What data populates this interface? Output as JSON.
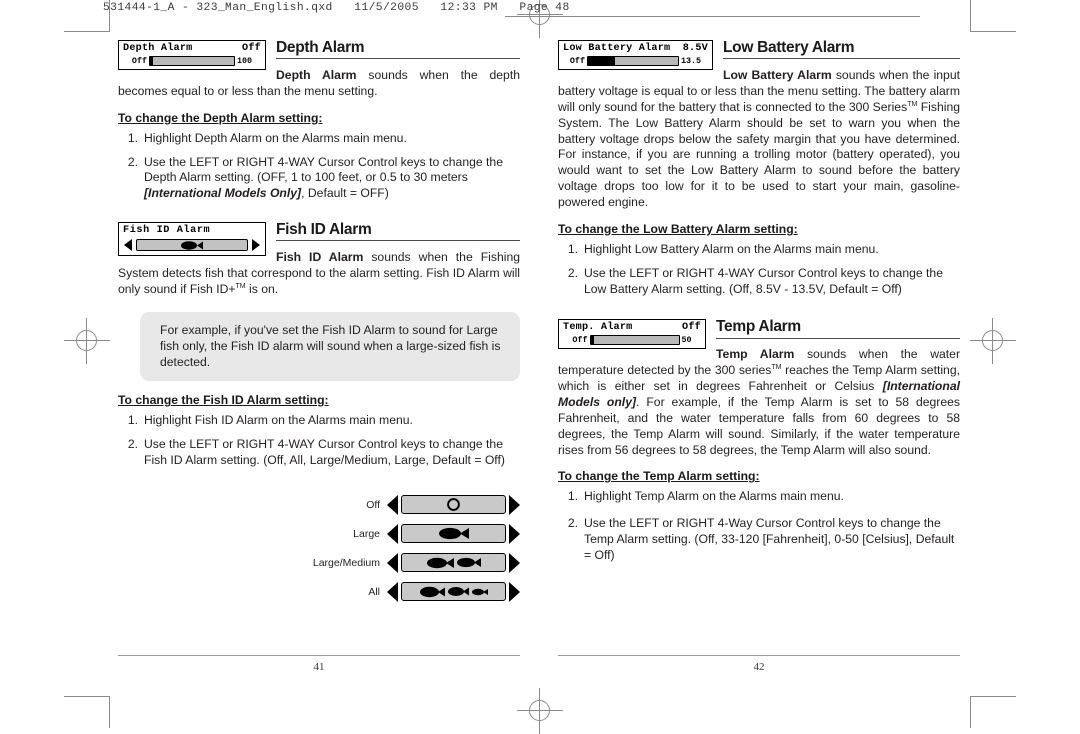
{
  "prepress": {
    "slug": "531444-1_A - 323_Man_English.qxd   11/5/2005   12:33 PM   Page 48"
  },
  "left_page": {
    "folio": "41",
    "sections": [
      {
        "id": "depth-alarm",
        "title": "Depth Alarm",
        "widget": {
          "type": "slider",
          "label": "Depth Alarm",
          "value": "Off",
          "min_label": "Off",
          "max_label": "100",
          "fill_percent": 0
        },
        "lead_bold": "Depth Alarm",
        "lead_text": " sounds when the depth becomes equal to or less than the menu setting.",
        "sub_head": "To change the Depth Alarm setting:",
        "steps": [
          {
            "num": "1.",
            "text": "Highlight Depth Alarm on the Alarms main menu."
          },
          {
            "num": "2.",
            "pre": "Use the LEFT or RIGHT 4-WAY Cursor Control keys to change the Depth Alarm setting. (OFF, 1 to 100 feet, or 0.5 to 30 meters ",
            "italic": "[International Models Only]",
            "post": ", Default = OFF)"
          }
        ]
      },
      {
        "id": "fish-id-alarm",
        "title": "Fish ID Alarm",
        "widget": {
          "type": "arrows",
          "label": "Fish ID Alarm",
          "icons": [
            "fish-large"
          ]
        },
        "lead_bold": "Fish ID Alarm",
        "lead_text": " sounds when the Fishing System detects fish that correspond to the alarm setting. Fish ID Alarm will only sound if Fish ID+",
        "lead_sup": "TM",
        "lead_tail": " is on.",
        "callout": "For example, if you've set the Fish ID Alarm to sound for Large fish only, the Fish ID alarm will sound when a large-sized fish is detected.",
        "sub_head": "To change the Fish ID Alarm setting:",
        "steps": [
          {
            "num": "1.",
            "text": "Highlight Fish ID Alarm on the Alarms main menu."
          },
          {
            "num": "2.",
            "text": "Use the LEFT or RIGHT 4-WAY Cursor Control keys to change the Fish ID Alarm setting. (Off, All, Large/Medium, Large, Default = Off)"
          }
        ]
      }
    ],
    "fish_legend": [
      {
        "label": "Off",
        "icons": [
          "circle-empty"
        ]
      },
      {
        "label": "Large",
        "icons": [
          "fish-large"
        ]
      },
      {
        "label": "Large/Medium",
        "icons": [
          "fish-large",
          "fish-medium"
        ]
      },
      {
        "label": "All",
        "icons": [
          "fish-large",
          "fish-medium",
          "fish-small"
        ]
      }
    ]
  },
  "right_page": {
    "folio": "42",
    "sections": [
      {
        "id": "low-battery-alarm",
        "title": "Low Battery Alarm",
        "widget": {
          "type": "slider",
          "label": "Low Battery Alarm",
          "value": "8.5V",
          "min_label": "Off",
          "max_label": "13.5",
          "fill_percent": 27
        },
        "lead_bold": "Low Battery Alarm",
        "lead_text": " sounds when the input battery voltage is equal to or less than the menu setting. The battery alarm will only sound for the battery that is connected to the 300 Series",
        "lead_sup": "TM",
        "lead_tail": " Fishing System. The Low Battery Alarm should be set to warn you when the battery voltage drops below the safety margin that you have determined. For instance, if you are running a trolling motor (battery operated), you would want to set the Low Battery Alarm to sound before the battery voltage drops too low for it to be used to start your main, gasoline-powered engine.",
        "sub_head": "To change the Low Battery Alarm setting:",
        "steps": [
          {
            "num": "1.",
            "text": "Highlight Low Battery Alarm on the Alarms main menu."
          },
          {
            "num": "2.",
            "text": "Use the LEFT or RIGHT 4-WAY Cursor Control keys to change the Low Battery Alarm setting. (Off, 8.5V - 13.5V,  Default = Off)"
          }
        ]
      },
      {
        "id": "temp-alarm",
        "title": "Temp Alarm",
        "widget": {
          "type": "slider",
          "label": "Temp. Alarm",
          "value": "Off",
          "min_label": "Off",
          "max_label": "50",
          "fill_percent": 0
        },
        "lead_bold": "Temp Alarm",
        "lead_text": " sounds when the water temperature detected by the 300 series",
        "lead_sup": "TM",
        "lead_tail_pre": " reaches the Temp Alarm setting, which is either set in degrees Fahrenheit or Celsius ",
        "lead_italic": "[International Models only]",
        "lead_tail": ". For example, if the Temp Alarm is set to 58 degrees Fahrenheit, and the water temperature falls from 60 degrees to 58 degrees, the Temp Alarm will sound. Similarly, if the water temperature rises from 56 degrees to 58 degrees, the Temp Alarm will also sound.",
        "sub_head": "To change the Temp Alarm setting:",
        "steps": [
          {
            "num": "1.",
            "text": "Highlight Temp Alarm on the Alarms main menu."
          },
          {
            "num": "2.",
            "text": "Use the LEFT or RIGHT 4-Way Cursor Control keys to change the Temp Alarm setting. (Off, 33-120 [Fahrenheit], 0-50 [Celsius], Default = Off)"
          }
        ]
      }
    ]
  }
}
